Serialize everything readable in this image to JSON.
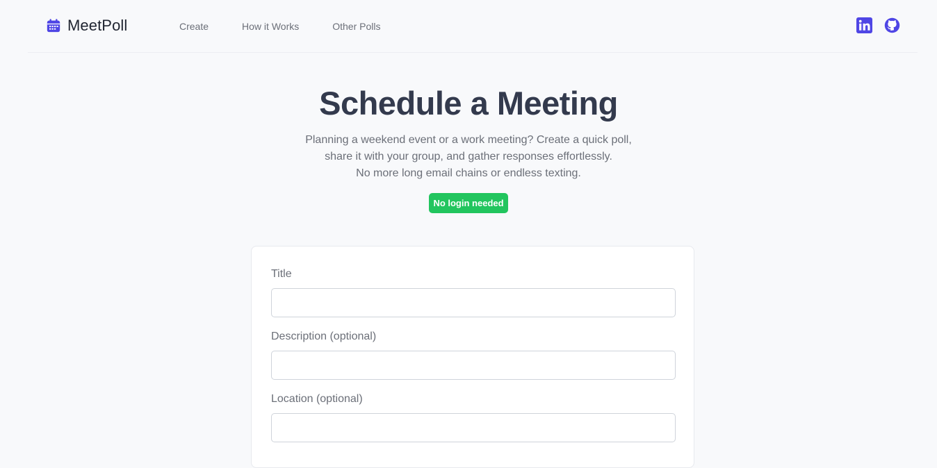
{
  "header": {
    "brand_name": "MeetPoll",
    "nav": [
      {
        "label": "Create"
      },
      {
        "label": "How it Works"
      },
      {
        "label": "Other Polls"
      }
    ],
    "social": [
      {
        "icon": "linkedin-icon"
      },
      {
        "icon": "github-icon"
      }
    ]
  },
  "hero": {
    "title": "Schedule a Meeting",
    "description_lines": [
      "Planning a weekend event or a work meeting? Create a quick poll,",
      "share it with your group, and gather responses effortlessly.",
      "No more long email chains or endless texting."
    ],
    "badge": "No login needed"
  },
  "form": {
    "fields": [
      {
        "label": "Title",
        "value": "",
        "placeholder": ""
      },
      {
        "label": "Description (optional)",
        "value": "",
        "placeholder": ""
      },
      {
        "label": "Location (optional)",
        "value": "",
        "placeholder": ""
      }
    ]
  },
  "colors": {
    "accent": "#4f46e5",
    "badge": "#22c55e",
    "heading": "#333a4d",
    "muted_text": "#6b6f78",
    "page_background": "#f8f9fb"
  }
}
